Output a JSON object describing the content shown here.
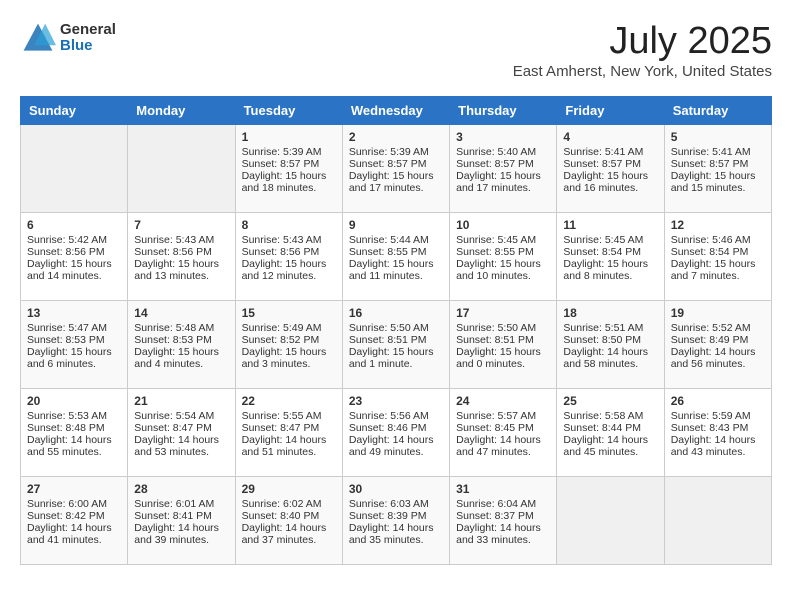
{
  "logo": {
    "general": "General",
    "blue": "Blue"
  },
  "title": {
    "month": "July 2025",
    "location": "East Amherst, New York, United States"
  },
  "headers": [
    "Sunday",
    "Monday",
    "Tuesday",
    "Wednesday",
    "Thursday",
    "Friday",
    "Saturday"
  ],
  "weeks": [
    [
      {
        "day": "",
        "info": "",
        "empty": true
      },
      {
        "day": "",
        "info": "",
        "empty": true
      },
      {
        "day": "1",
        "info": "Sunrise: 5:39 AM\nSunset: 8:57 PM\nDaylight: 15 hours and 18 minutes."
      },
      {
        "day": "2",
        "info": "Sunrise: 5:39 AM\nSunset: 8:57 PM\nDaylight: 15 hours and 17 minutes."
      },
      {
        "day": "3",
        "info": "Sunrise: 5:40 AM\nSunset: 8:57 PM\nDaylight: 15 hours and 17 minutes."
      },
      {
        "day": "4",
        "info": "Sunrise: 5:41 AM\nSunset: 8:57 PM\nDaylight: 15 hours and 16 minutes."
      },
      {
        "day": "5",
        "info": "Sunrise: 5:41 AM\nSunset: 8:57 PM\nDaylight: 15 hours and 15 minutes."
      }
    ],
    [
      {
        "day": "6",
        "info": "Sunrise: 5:42 AM\nSunset: 8:56 PM\nDaylight: 15 hours and 14 minutes."
      },
      {
        "day": "7",
        "info": "Sunrise: 5:43 AM\nSunset: 8:56 PM\nDaylight: 15 hours and 13 minutes."
      },
      {
        "day": "8",
        "info": "Sunrise: 5:43 AM\nSunset: 8:56 PM\nDaylight: 15 hours and 12 minutes."
      },
      {
        "day": "9",
        "info": "Sunrise: 5:44 AM\nSunset: 8:55 PM\nDaylight: 15 hours and 11 minutes."
      },
      {
        "day": "10",
        "info": "Sunrise: 5:45 AM\nSunset: 8:55 PM\nDaylight: 15 hours and 10 minutes."
      },
      {
        "day": "11",
        "info": "Sunrise: 5:45 AM\nSunset: 8:54 PM\nDaylight: 15 hours and 8 minutes."
      },
      {
        "day": "12",
        "info": "Sunrise: 5:46 AM\nSunset: 8:54 PM\nDaylight: 15 hours and 7 minutes."
      }
    ],
    [
      {
        "day": "13",
        "info": "Sunrise: 5:47 AM\nSunset: 8:53 PM\nDaylight: 15 hours and 6 minutes."
      },
      {
        "day": "14",
        "info": "Sunrise: 5:48 AM\nSunset: 8:53 PM\nDaylight: 15 hours and 4 minutes."
      },
      {
        "day": "15",
        "info": "Sunrise: 5:49 AM\nSunset: 8:52 PM\nDaylight: 15 hours and 3 minutes."
      },
      {
        "day": "16",
        "info": "Sunrise: 5:50 AM\nSunset: 8:51 PM\nDaylight: 15 hours and 1 minute."
      },
      {
        "day": "17",
        "info": "Sunrise: 5:50 AM\nSunset: 8:51 PM\nDaylight: 15 hours and 0 minutes."
      },
      {
        "day": "18",
        "info": "Sunrise: 5:51 AM\nSunset: 8:50 PM\nDaylight: 14 hours and 58 minutes."
      },
      {
        "day": "19",
        "info": "Sunrise: 5:52 AM\nSunset: 8:49 PM\nDaylight: 14 hours and 56 minutes."
      }
    ],
    [
      {
        "day": "20",
        "info": "Sunrise: 5:53 AM\nSunset: 8:48 PM\nDaylight: 14 hours and 55 minutes."
      },
      {
        "day": "21",
        "info": "Sunrise: 5:54 AM\nSunset: 8:47 PM\nDaylight: 14 hours and 53 minutes."
      },
      {
        "day": "22",
        "info": "Sunrise: 5:55 AM\nSunset: 8:47 PM\nDaylight: 14 hours and 51 minutes."
      },
      {
        "day": "23",
        "info": "Sunrise: 5:56 AM\nSunset: 8:46 PM\nDaylight: 14 hours and 49 minutes."
      },
      {
        "day": "24",
        "info": "Sunrise: 5:57 AM\nSunset: 8:45 PM\nDaylight: 14 hours and 47 minutes."
      },
      {
        "day": "25",
        "info": "Sunrise: 5:58 AM\nSunset: 8:44 PM\nDaylight: 14 hours and 45 minutes."
      },
      {
        "day": "26",
        "info": "Sunrise: 5:59 AM\nSunset: 8:43 PM\nDaylight: 14 hours and 43 minutes."
      }
    ],
    [
      {
        "day": "27",
        "info": "Sunrise: 6:00 AM\nSunset: 8:42 PM\nDaylight: 14 hours and 41 minutes."
      },
      {
        "day": "28",
        "info": "Sunrise: 6:01 AM\nSunset: 8:41 PM\nDaylight: 14 hours and 39 minutes."
      },
      {
        "day": "29",
        "info": "Sunrise: 6:02 AM\nSunset: 8:40 PM\nDaylight: 14 hours and 37 minutes."
      },
      {
        "day": "30",
        "info": "Sunrise: 6:03 AM\nSunset: 8:39 PM\nDaylight: 14 hours and 35 minutes."
      },
      {
        "day": "31",
        "info": "Sunrise: 6:04 AM\nSunset: 8:37 PM\nDaylight: 14 hours and 33 minutes."
      },
      {
        "day": "",
        "info": "",
        "empty": true
      },
      {
        "day": "",
        "info": "",
        "empty": true
      }
    ]
  ]
}
